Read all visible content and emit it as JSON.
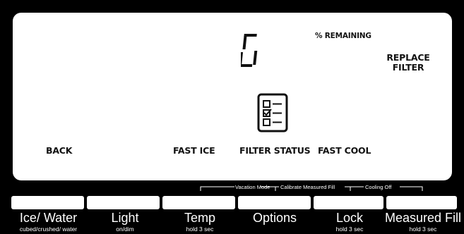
{
  "display": {
    "percent_remaining_label": "% REMAINING",
    "replace_filter_label": "REPLACE FILTER",
    "back_label": "BACK",
    "fast_ice_label": "FAST ICE",
    "filter_status_label": "FILTER STATUS",
    "fast_cool_label": "FAST COOL",
    "checklist_icon": "checklist-icon"
  },
  "hold_labels": {
    "vacation_mode": "Vacation Mode",
    "calibrate_measured_fill": "Calibrate Measured Fill",
    "cooling_off": "Cooling Off"
  },
  "buttons": [
    {
      "label": "Ice/ Water",
      "sub": "cubed/crushed/ water"
    },
    {
      "label": "Light",
      "sub": "on/dim"
    },
    {
      "label": "Temp",
      "sub": "hold 3 sec"
    },
    {
      "label": "Options",
      "sub": ""
    },
    {
      "label": "Lock",
      "sub": "hold 3 sec"
    },
    {
      "label": "Measured Fill",
      "sub": "hold 3 sec"
    }
  ]
}
